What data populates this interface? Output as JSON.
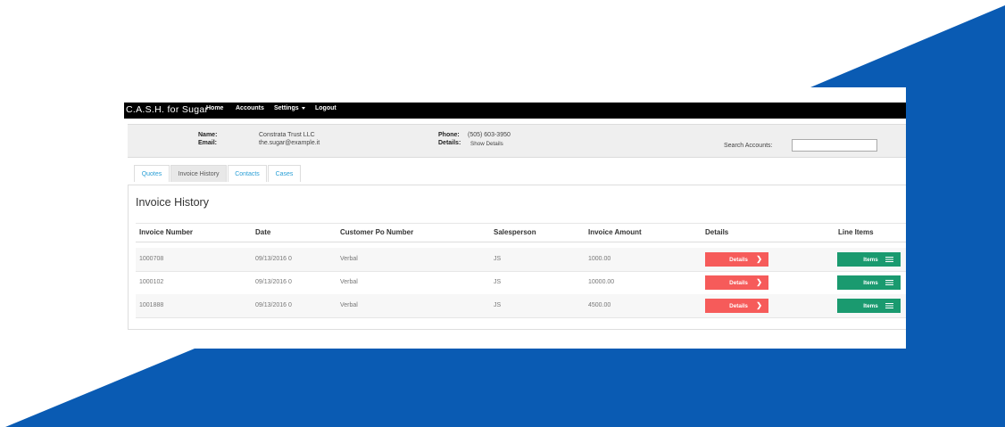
{
  "navbar": {
    "brand": "C.A.S.H. for Sugar",
    "links": [
      "Home",
      "Accounts",
      "Settings",
      "Logout"
    ]
  },
  "account": {
    "name_label": "Name:",
    "name": "Constrata Trust LLC",
    "email_label": "Email:",
    "email": "the.sugar@example.it",
    "phone_label": "Phone:",
    "phone": "(505) 603-3950",
    "details_label": "Details:",
    "details_link": "Show Details",
    "search_label": "Search Accounts:",
    "search_value": ""
  },
  "tabs": [
    "Quotes",
    "Invoice History",
    "Contacts",
    "Cases"
  ],
  "active_tab": "Invoice History",
  "panel": {
    "title": "Invoice History",
    "columns": [
      "Invoice Number",
      "Date",
      "Customer Po Number",
      "Salesperson",
      "Invoice Amount",
      "Details",
      "Line Items"
    ],
    "rows": [
      {
        "invoice": "1000708",
        "date": "09/13/2016 0",
        "po": "Verbal",
        "salesperson": "JS",
        "amount": "1000.00"
      },
      {
        "invoice": "1000102",
        "date": "09/13/2016 0",
        "po": "Verbal",
        "salesperson": "JS",
        "amount": "10000.00"
      },
      {
        "invoice": "1001888",
        "date": "09/13/2016 0",
        "po": "Verbal",
        "salesperson": "JS",
        "amount": "4500.00"
      }
    ],
    "details_button": "Details",
    "items_button": "Items"
  },
  "icons": {
    "chevron": "chevron-right-icon",
    "list": "list-icon",
    "caret": "caret-down-icon"
  },
  "colors": {
    "navbar": "#000000",
    "details_button": "#f65b5a",
    "items_button": "#1a9a6f",
    "tab_link": "#2a9fd6",
    "background_shape": "#0a5bb3"
  }
}
